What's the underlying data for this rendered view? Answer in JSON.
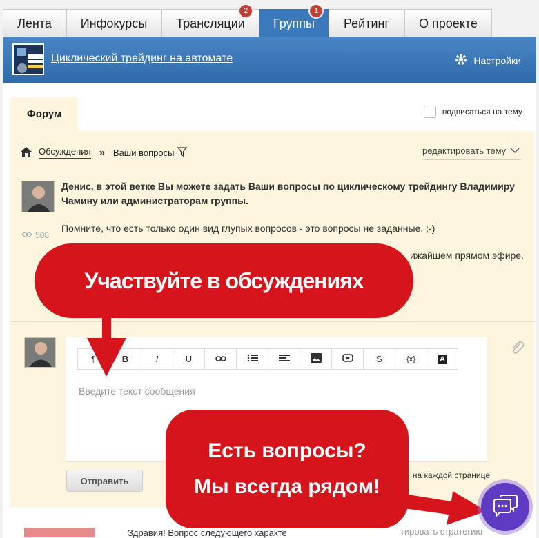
{
  "tabs": [
    {
      "label": "Лента",
      "badge": "",
      "active": false
    },
    {
      "label": "Инфокурсы",
      "badge": "",
      "active": false
    },
    {
      "label": "Трансляции",
      "badge": "2",
      "active": false
    },
    {
      "label": "Группы",
      "badge": "1",
      "active": true
    },
    {
      "label": "Рейтинг",
      "badge": "",
      "active": false
    },
    {
      "label": "О проекте",
      "badge": "",
      "active": false
    }
  ],
  "group": {
    "title": "Циклический трейдинг на автомате",
    "settings_label": "Настройки"
  },
  "forum": {
    "tab_label": "Форум",
    "subscribe_label": "подписаться на тему",
    "breadcrumb_home": "Обсуждения",
    "breadcrumb_current": "Ваши вопросы",
    "edit_topic_label": "редактировать тему",
    "post_bold": "Денис, в этой ветке Вы можете задать Ваши вопросы по циклическому трейдингу Владимиру Чамину или администраторам группы.",
    "post_line2": "Помните, что есть только один вид глупых вопросов - это вопросы не заданные. ;-)",
    "post_line3_visible": "ижайшем прямом эфире.",
    "views": "508",
    "editor_placeholder": "Введите текст сообщения",
    "send_label": "Отправить",
    "per_page_label": "на каждой странице",
    "bottom_text": "Здравия! Вопрос следующего характе",
    "bottom_right_text": "тировать стратегию"
  },
  "toolbar": [
    "¶",
    "B",
    "I",
    "U",
    "link",
    "list",
    "align",
    "image",
    "video",
    "S",
    "{x}",
    "A"
  ],
  "callouts": {
    "top": "Участвуйте в обсуждениях",
    "bottom_line1": "Есть вопросы?",
    "bottom_line2": "Мы всегда рядом!"
  },
  "colors": {
    "tab_active": "#3b79bd",
    "callout_red": "#d5151b",
    "chat_purple": "#5f3bc4",
    "forum_bg": "#fdf5dd"
  }
}
